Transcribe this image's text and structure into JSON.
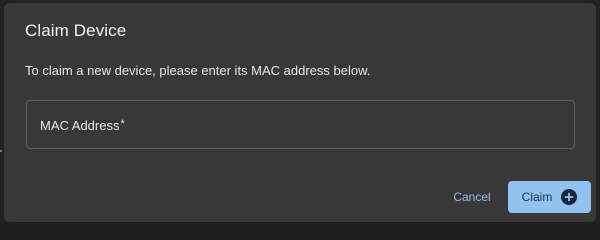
{
  "dialog": {
    "title": "Claim Device",
    "description": "To claim a new device, please enter its MAC address below.",
    "mac_field": {
      "label": "MAC Address",
      "required_marker": "*",
      "value": "",
      "placeholder": ""
    },
    "cancel_label": "Cancel",
    "claim_label": "Claim",
    "claim_icon": "plus-circle-icon"
  },
  "colors": {
    "dialog_bg": "#383838",
    "accent": "#92c3f0",
    "link": "#8fbff0"
  }
}
